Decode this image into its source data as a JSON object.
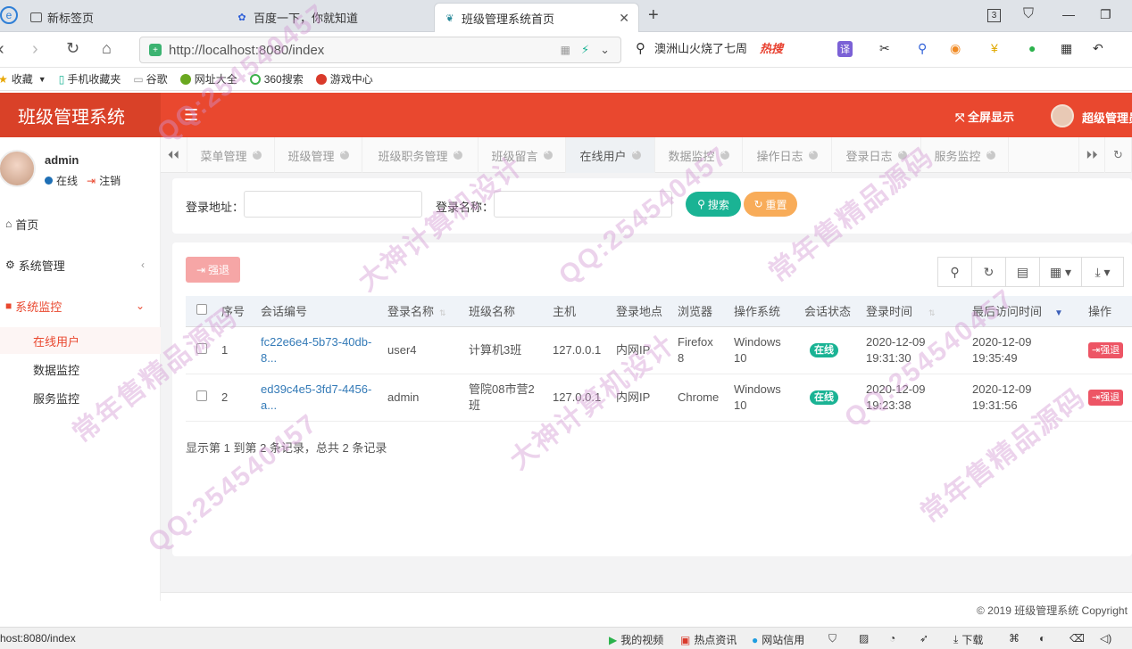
{
  "browser": {
    "tabs": [
      {
        "label": "新标签页",
        "icon": "page-icon"
      },
      {
        "label": "百度一下，你就知道",
        "icon": "baidu-paw-icon"
      },
      {
        "label": "班级管理系统首页",
        "icon": "leaf-icon"
      }
    ],
    "tab_count": "3",
    "url": "http://localhost:8080/index",
    "search_text": "澳洲山火烧了七周",
    "hot_label": "热搜",
    "bookmarks": [
      "收藏",
      "手机收藏夹",
      "谷歌",
      "网址大全",
      "360搜索",
      "游戏中心"
    ]
  },
  "app": {
    "logo": "班级管理系统",
    "fullscreen": "全屏显示",
    "username": "超级管理员",
    "accent": "#e9482f"
  },
  "sidebar": {
    "user": "admin",
    "status": "在线",
    "logout": "注销",
    "menus": {
      "home": "首页",
      "system": "系统管理",
      "monitor": "系统监控"
    },
    "submenus": [
      "在线用户",
      "数据监控",
      "服务监控"
    ]
  },
  "pagetabs": [
    "菜单管理",
    "班级管理",
    "班级职务管理",
    "班级留言",
    "在线用户",
    "数据监控",
    "操作日志",
    "登录日志",
    "服务监控"
  ],
  "search": {
    "addr_label": "登录地址：",
    "name_label": "登录名称：",
    "search_btn": "搜索",
    "reset_btn": "重置"
  },
  "table": {
    "force_btn": "强退",
    "headers": [
      "序号",
      "会话编号",
      "登录名称",
      "班级名称",
      "主机",
      "登录地点",
      "浏览器",
      "操作系统",
      "会话状态",
      "登录时间",
      "最后访问时间",
      "操作"
    ],
    "rows": [
      {
        "no": "1",
        "session1": "fc22e6e4-5b73-40db-",
        "session2": "8...",
        "login": "user4",
        "cls1": "计算机3班",
        "cls2": "",
        "host": "127.0.0.1",
        "loc": "内网IP",
        "br1": "Firefox",
        "br2": "8",
        "os1": "Windows",
        "os2": "10",
        "status": "在线",
        "lt1": "2020-12-09",
        "lt2": "19:31:30",
        "la1": "2020-12-09",
        "la2": "19:35:49",
        "op": "强退"
      },
      {
        "no": "2",
        "session1": "ed39c4e5-3fd7-4456-",
        "session2": "a...",
        "login": "admin",
        "cls1": "管院08市营2",
        "cls2": "班",
        "host": "127.0.0.1",
        "loc": "内网IP",
        "br1": "Chrome",
        "br2": "",
        "os1": "Windows",
        "os2": "10",
        "status": "在线",
        "lt1": "2020-12-09",
        "lt2": "19:23:38",
        "la1": "2020-12-09",
        "la2": "19:31:56",
        "op": "强退"
      }
    ],
    "page_info": "显示第 1 到第 2 条记录，总共 2 条记录"
  },
  "footer": {
    "copyright": "© 2019 班级管理系统 Copyright"
  },
  "statusbar": {
    "url": "host:8080/index",
    "items": [
      "我的视频",
      "热点资讯",
      "网站信用",
      "下载"
    ]
  },
  "watermarks": [
    "QQ:254540457",
    "大神计算机设计",
    "常年售精品源码"
  ]
}
